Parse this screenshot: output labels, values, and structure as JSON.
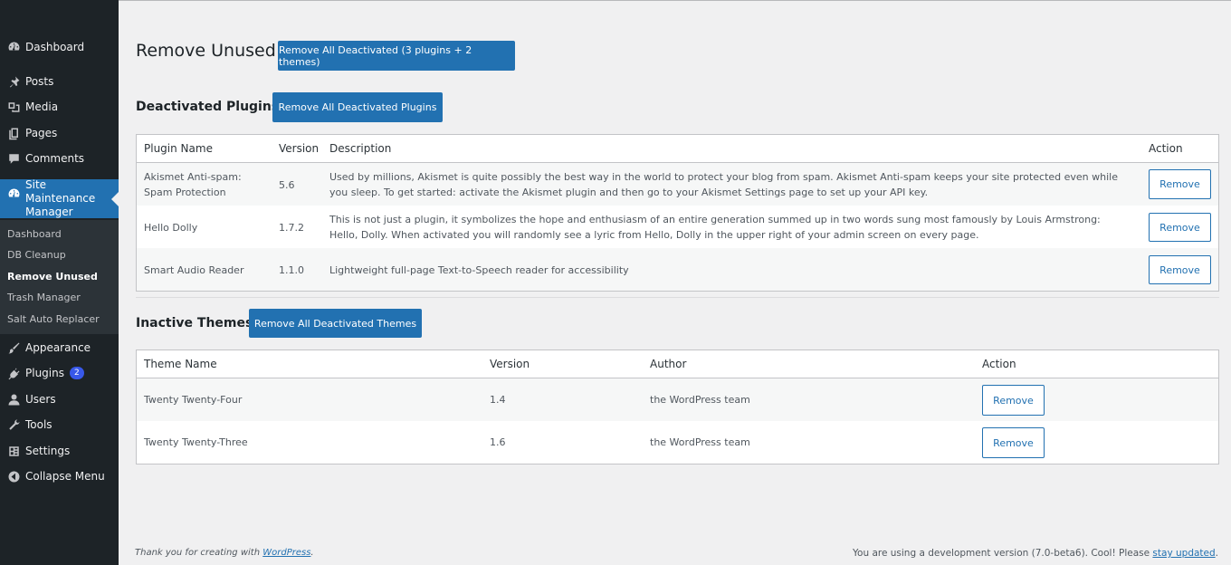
{
  "sidebar": {
    "menu": [
      {
        "label": "Dashboard",
        "icon": "dashboard-icon"
      },
      {
        "label": "Posts",
        "icon": "pin-icon"
      },
      {
        "label": "Media",
        "icon": "media-icon"
      },
      {
        "label": "Pages",
        "icon": "pages-icon"
      },
      {
        "label": "Comments",
        "icon": "comment-icon"
      },
      {
        "label": "Site Maintenance Manager",
        "icon": "site-maintenance-icon"
      },
      {
        "label": "Appearance",
        "icon": "brush-icon"
      },
      {
        "label": "Plugins",
        "icon": "plug-icon",
        "badge": "2"
      },
      {
        "label": "Users",
        "icon": "user-icon"
      },
      {
        "label": "Tools",
        "icon": "wrench-icon"
      },
      {
        "label": "Settings",
        "icon": "settings-icon"
      },
      {
        "label": "Collapse Menu",
        "icon": "collapse-icon"
      }
    ],
    "submenu": [
      {
        "label": "Dashboard"
      },
      {
        "label": "DB Cleanup"
      },
      {
        "label": "Remove Unused"
      },
      {
        "label": "Trash Manager"
      },
      {
        "label": "Salt Auto Replacer"
      }
    ]
  },
  "page": {
    "title": "Remove Unused",
    "remove_all_button": "Remove All Deactivated (3 plugins + 2 themes)"
  },
  "plugins": {
    "heading": "Deactivated Plugins",
    "button": "Remove All Deactivated Plugins",
    "columns": [
      "Plugin Name",
      "Version",
      "Description",
      "Action"
    ],
    "rows": [
      {
        "name": "Akismet Anti-spam: Spam Protection",
        "version": "5.6",
        "description": "Used by millions, Akismet is quite possibly the best way in the world to protect your blog from spam. Akismet Anti-spam keeps your site protected even while you sleep. To get started: activate the Akismet plugin and then go to your Akismet Settings page to set up your API key.",
        "action": "Remove"
      },
      {
        "name": "Hello Dolly",
        "version": "1.7.2",
        "description": "This is not just a plugin, it symbolizes the hope and enthusiasm of an entire generation summed up in two words sung most famously by Louis Armstrong: Hello, Dolly. When activated you will randomly see a lyric from Hello, Dolly in the upper right of your admin screen on every page.",
        "action": "Remove"
      },
      {
        "name": "Smart Audio Reader",
        "version": "1.1.0",
        "description": "Lightweight full-page Text-to-Speech reader for accessibility",
        "action": "Remove"
      }
    ]
  },
  "themes": {
    "heading": "Inactive Themes",
    "button": "Remove All Deactivated Themes",
    "columns": [
      "Theme Name",
      "Version",
      "Author",
      "Action"
    ],
    "rows": [
      {
        "name": "Twenty Twenty-Four",
        "version": "1.4",
        "author": "the WordPress team",
        "action": "Remove"
      },
      {
        "name": "Twenty Twenty-Three",
        "version": "1.6",
        "author": "the WordPress team",
        "action": "Remove"
      }
    ]
  },
  "footer": {
    "left_text": "Thank you for creating with",
    "left_link": "WordPress",
    "left_end": ".",
    "right_text": "You are using a development version (7.0-beta6). Cool! Please",
    "right_link": "stay updated",
    "right_end": "."
  },
  "colors": {
    "sidebar_bg": "#1d2327",
    "accent": "#2271b1",
    "badge": "#3858e9"
  }
}
